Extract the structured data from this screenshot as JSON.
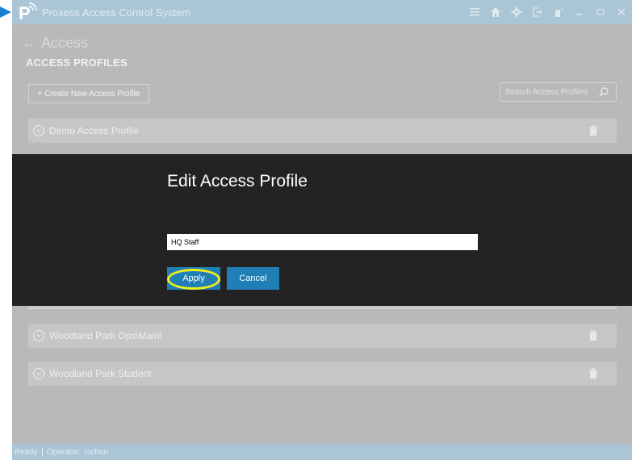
{
  "titlebar": {
    "title": "Proxess Access Control System",
    "icons": [
      "menu-icon",
      "home-icon",
      "gear-icon",
      "logout-icon",
      "card-reader-icon",
      "minimize-icon",
      "maximize-icon",
      "close-icon"
    ]
  },
  "header": {
    "back_label": "Access",
    "section_title": "ACCESS PROFILES"
  },
  "toolbar": {
    "create_label": "+ Create New Access Profile",
    "search_placeholder": "Search Access Profiles"
  },
  "profiles": [
    {
      "name": "Demo Access Profile"
    },
    {
      "name": "Woodland Park Ops\\Maint"
    },
    {
      "name": "Woodland Park Student"
    }
  ],
  "modal": {
    "title": "Edit Access Profile",
    "input_value": "HQ Staff",
    "apply_label": "Apply",
    "cancel_label": "Cancel"
  },
  "status": {
    "state": "Ready",
    "operator_label": "Operator:",
    "operator_name": "rschon"
  },
  "colors": {
    "accent": "#1f7fb6",
    "titlebar": "#a9c5d6",
    "highlight": "#f2ee1b",
    "modal_bg": "#232323"
  }
}
